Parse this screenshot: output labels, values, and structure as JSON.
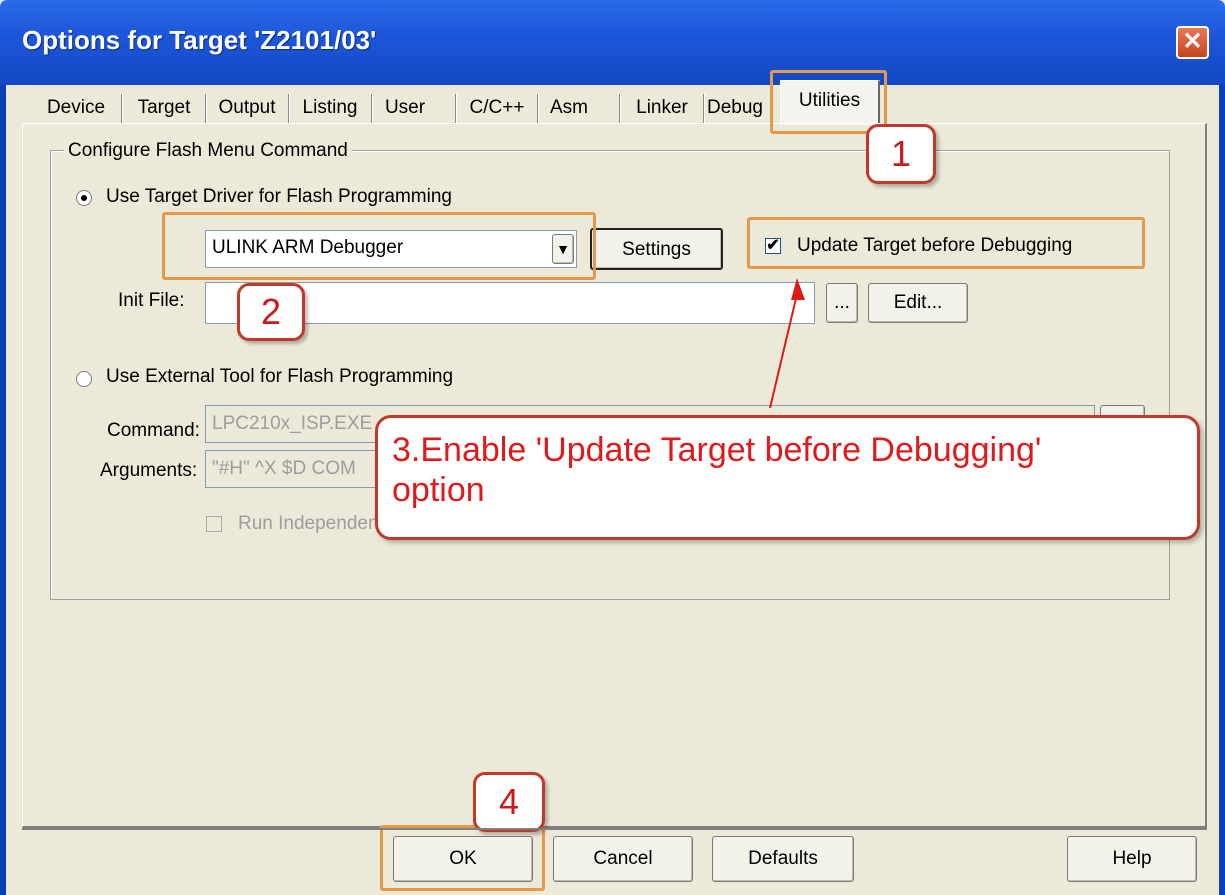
{
  "window": {
    "title": "Options for Target 'Z2101/03'",
    "close_label": "✕"
  },
  "tabs": [
    {
      "label": "Device"
    },
    {
      "label": "Target"
    },
    {
      "label": "Output"
    },
    {
      "label": "Listing"
    },
    {
      "label": "User"
    },
    {
      "label": "C/C++"
    },
    {
      "label": "Asm"
    },
    {
      "label": "Linker"
    },
    {
      "label": "Debug"
    },
    {
      "label": "Utilities",
      "active": true
    }
  ],
  "group": {
    "title": "Configure Flash Menu Command",
    "use_target_driver": {
      "label": "Use Target Driver for Flash Programming",
      "selected": true
    },
    "driver_select": {
      "value": "ULINK ARM Debugger"
    },
    "settings_button": "Settings",
    "update_checkbox": {
      "label": "Update Target before Debugging",
      "checked": true,
      "mark": "✔"
    },
    "init_file": {
      "label": "Init File:",
      "value": "",
      "browse_label": "...",
      "edit_label": "Edit..."
    },
    "use_external": {
      "label": "Use External Tool for Flash Programming",
      "selected": false
    },
    "command": {
      "label": "Command:",
      "value": "LPC210x_ISP.EXE"
    },
    "arguments": {
      "label": "Arguments:",
      "value": "\"#H\" ^X $D COM"
    },
    "run_independent": {
      "label": "Run Independent",
      "checked": false
    }
  },
  "annotations": {
    "badge1": "1",
    "badge2": "2",
    "badge4": "4",
    "callout_line1": "3.Enable 'Update Target before Debugging'",
    "callout_line2": "option"
  },
  "footer": {
    "ok": "OK",
    "cancel": "Cancel",
    "defaults": "Defaults",
    "help": "Help"
  },
  "colors": {
    "title_bar": "#1c56d8",
    "highlight": "#e39a4a",
    "annotation_red": "#e01a1a"
  }
}
